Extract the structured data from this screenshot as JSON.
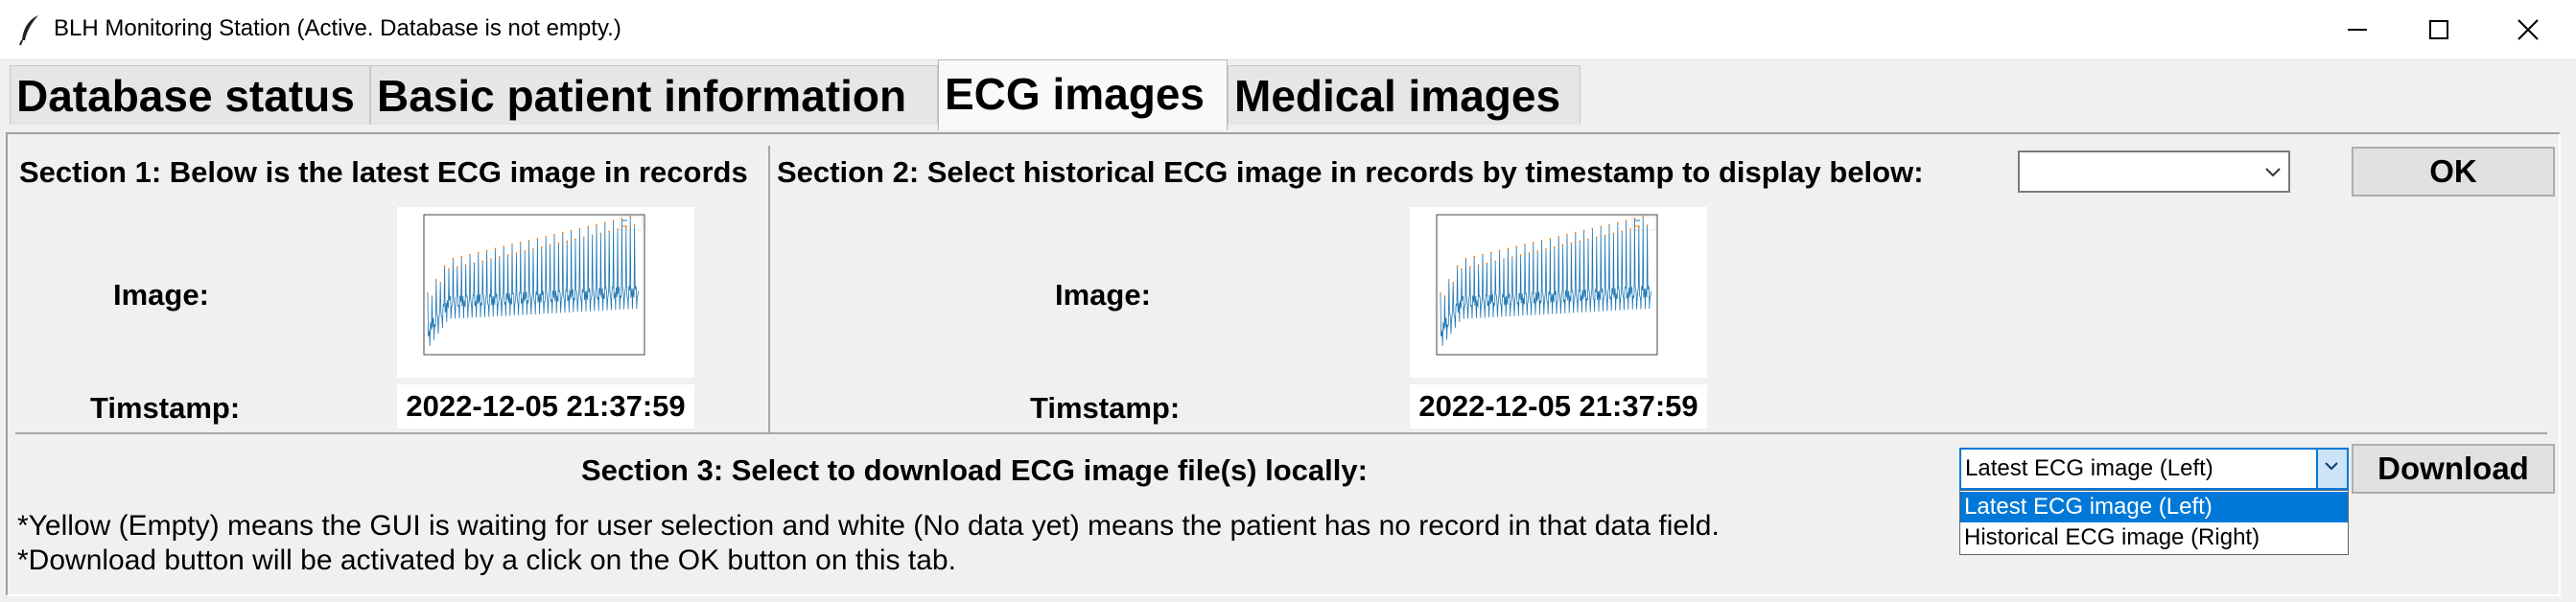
{
  "window": {
    "title": "BLH Monitoring Station (Active. Database is not empty.)",
    "icon": "feather-icon"
  },
  "tabs": [
    {
      "label": "Database status",
      "active": false
    },
    {
      "label": "Basic patient information",
      "active": false
    },
    {
      "label": "ECG images",
      "active": true
    },
    {
      "label": "Medical images",
      "active": false
    }
  ],
  "section1": {
    "heading": "Section 1: Below is the latest ECG image in records",
    "image_label": "Image:",
    "timestamp_label": "Timstamp:",
    "timestamp_value": "2022-12-05 21:37:59"
  },
  "section2": {
    "heading": "Section 2: Select historical ECG image in records by timestamp to display below:",
    "select_value": "",
    "ok_label": "OK",
    "image_label": "Image:",
    "timestamp_label": "Timstamp:",
    "timestamp_value": "2022-12-05 21:37:59"
  },
  "section3": {
    "heading": "Section 3: Select to download ECG image file(s) locally:",
    "select_value": "Latest ECG image (Left)",
    "options": [
      "Latest ECG image (Left)",
      "Historical ECG image (Right)"
    ],
    "selected_option": "Latest ECG image (Left)",
    "download_label": "Download"
  },
  "notes": [
    "*Yellow (Empty) means the GUI is waiting for user selection and white (No data yet) means the patient has no record in that data field.",
    "*Download button will be activated by a click on the OK button on this tab."
  ],
  "colors": {
    "accent": "#0078d7",
    "background": "#f0f0f0",
    "ecg_signal": "#1f77b4",
    "ecg_peaks": "#ff7f0e"
  }
}
